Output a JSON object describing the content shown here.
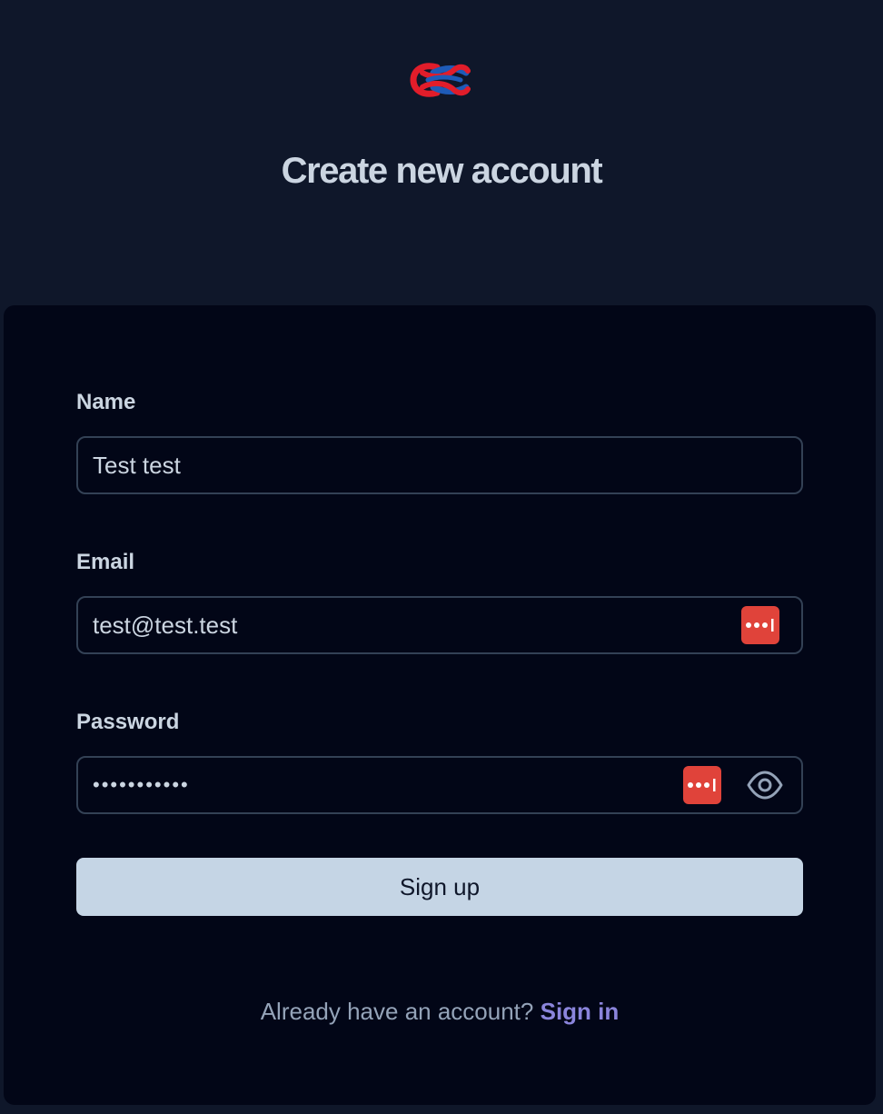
{
  "logo": {
    "icon": "knot-logo-icon",
    "colors": {
      "primary": "#e11d2a",
      "secondary": "#1e5bb8"
    }
  },
  "page_title": "Create new account",
  "form": {
    "name": {
      "label": "Name",
      "value": "Test test"
    },
    "email": {
      "label": "Email",
      "value": "test@test.test",
      "autofill_icon": "password-manager-icon"
    },
    "password": {
      "label": "Password",
      "value": "•••••••••••",
      "autofill_icon": "password-manager-icon",
      "toggle_icon": "eye-icon"
    },
    "submit_label": "Sign up"
  },
  "footer": {
    "prompt": "Already have an account?",
    "link_label": "Sign in"
  },
  "colors": {
    "page_background": "#0f172a",
    "card_background": "#020617",
    "button_background": "#c5d5e5",
    "link": "#8b85dc",
    "password_manager": "#e0433a"
  }
}
